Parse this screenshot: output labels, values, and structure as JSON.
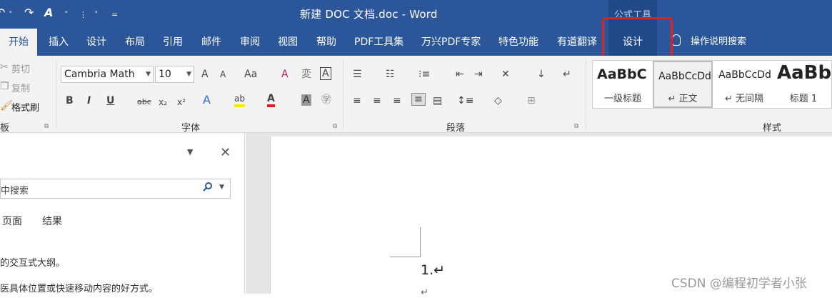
{
  "window": {
    "title": "新建 DOC 文档.doc - Word",
    "contextual_group": "公式工具"
  },
  "quick_access": {
    "undo": "↶",
    "redo": "↷",
    "format_painter": "A",
    "custom": "⋮",
    "more": "˅",
    "more2": "˅",
    "pin": "="
  },
  "tabs": [
    "开始",
    "插入",
    "设计",
    "布局",
    "引用",
    "邮件",
    "审阅",
    "视图",
    "帮助",
    "PDF工具集",
    "万兴PDF专家",
    "特色功能",
    "有道翻译"
  ],
  "contextual_tab": "设计",
  "tell_me": "操作说明搜索",
  "clipboard": {
    "cut": "剪切",
    "copy": "复制",
    "format_painter": "格式刷",
    "label": "板"
  },
  "font": {
    "name": "Cambria Math",
    "size": "10",
    "label": "字体",
    "buttons": [
      "A",
      "A",
      "Aa",
      "A",
      "B",
      "I",
      "U",
      "abc",
      "x₂",
      "x²",
      "A",
      "A",
      "A"
    ]
  },
  "paragraph": {
    "label": "段落"
  },
  "styles": {
    "label": "样式",
    "items": [
      {
        "sample": "AaBbC",
        "name": "一级标题"
      },
      {
        "sample": "AaBbCcDd",
        "name": "↵ 正文"
      },
      {
        "sample": "AaBbCcDd",
        "name": "↵ 无间隔"
      },
      {
        "sample": "AaBb",
        "name": "标题 1"
      }
    ]
  },
  "nav_pane": {
    "search_placeholder": "中搜索",
    "tabs": [
      "页面",
      "结果"
    ],
    "line1": "的交互式大纲。",
    "line2": "医具体位置或快速移动内容的好方式。"
  },
  "document": {
    "list_item": "1.↵",
    "list_item2": "↵"
  },
  "watermark": "CSDN @编程初学者小张",
  "colors": {
    "brand": "#2b579a",
    "highlight": "#e02020",
    "context_tab": "#1f4a87"
  }
}
